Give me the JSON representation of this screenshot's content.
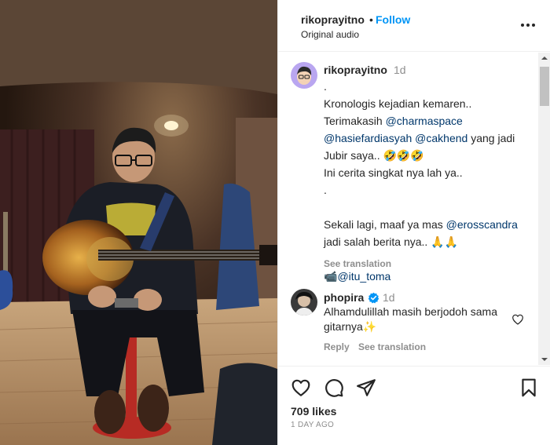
{
  "header": {
    "username": "rikoprayitno",
    "separator": "•",
    "follow_label": "Follow",
    "audio": "Original audio",
    "more_icon": "more-horizontal-icon"
  },
  "caption": {
    "username": "rikoprayitno",
    "time": "1d",
    "lines": [
      ".",
      "Kronologis kejadian kemaren..",
      "Terimakasih ",
      "",
      "Jubir saya.. 🤣🤣🤣",
      "Ini cerita singkat nya lah ya..",
      ".",
      "",
      "Sekali lagi, maaf ya mas ",
      "jadi salah berita nya.. 🙏🙏",
      ".",
      "📹"
    ],
    "mentions": {
      "charmaspace": "@charmaspace",
      "hasiefardiasyah": "@hasiefardiasyah",
      "cakhend": "@cakhend",
      "erosscandra": "@erosscandra",
      "itu_toma": "@itu_toma"
    },
    "yang_jadi": " yang jadi",
    "see_translation": "See translation"
  },
  "comment": {
    "username": "phopira",
    "time": "1d",
    "text": "Alhamdulillah masih berjodoh sama gitarnya✨",
    "reply_label": "Reply",
    "see_translation": "See translation"
  },
  "footer": {
    "likes": "709 likes",
    "date": "1 DAY AGO"
  },
  "colors": {
    "link": "#0095f6",
    "mention": "#00376b",
    "muted": "#8e8e8e",
    "verified": "#0095f6"
  }
}
